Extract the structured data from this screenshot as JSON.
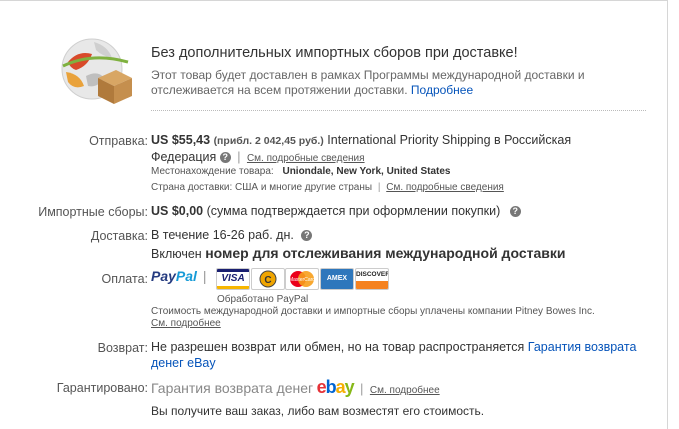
{
  "promo": {
    "title": "Без дополнительных импортных сборов при доставке!",
    "desc": "Этот товар будет доставлен в рамках Программы международной доставки и отслеживается на всем протяжении доставки.",
    "more_link": "Подробнее"
  },
  "shipping": {
    "label": "Отправка:",
    "price": "US $55,43",
    "approx": "(прибл. 2 042,45 руб.)",
    "service": "International Priority Shipping в Российская Федерация",
    "details_link": "См. подробные сведения",
    "location_label": "Местонахождение товара:",
    "location": "Uniondale, New York, United States",
    "countries_label": "Страна доставки:",
    "countries": "США и многие другие страны",
    "countries_link": "См. подробные сведения"
  },
  "import": {
    "label": "Импортные сборы:",
    "amount": "US $0,00",
    "note": "(сумма подтверждается при оформлении покупки)"
  },
  "delivery": {
    "label": "Доставка:",
    "time": "В течение 16-26 раб. дн.",
    "included": "Включен",
    "tracking": "номер для отслеживания международной доставки"
  },
  "payment": {
    "label": "Оплата:",
    "paypal_pay": "Pay",
    "paypal_pal": "Pal",
    "processed": "Обработано PayPal",
    "cards": [
      "VISA",
      "MasterCard",
      "AMEX",
      "DISCOVER"
    ],
    "note": "Стоимость международной доставки и импортные сборы уплачены компании Pitney Bowes Inc.",
    "note_link": "См. подробнее"
  },
  "returns": {
    "label": "Возврат:",
    "text": "Не разрешен возврат или обмен, но на товар распространяется",
    "link": "Гарантия возврата денег eBay"
  },
  "guarantee": {
    "label": "Гарантировано:",
    "text": "Гарантия возврата денег",
    "ebay": [
      "e",
      "b",
      "a",
      "y"
    ],
    "link": "См. подробнее",
    "desc": "Вы получите ваш заказ, либо вам возместят его стоимость."
  },
  "colors": {
    "link": "#0654ba",
    "paypal_dark": "#253b80",
    "paypal_light": "#179bd7"
  }
}
